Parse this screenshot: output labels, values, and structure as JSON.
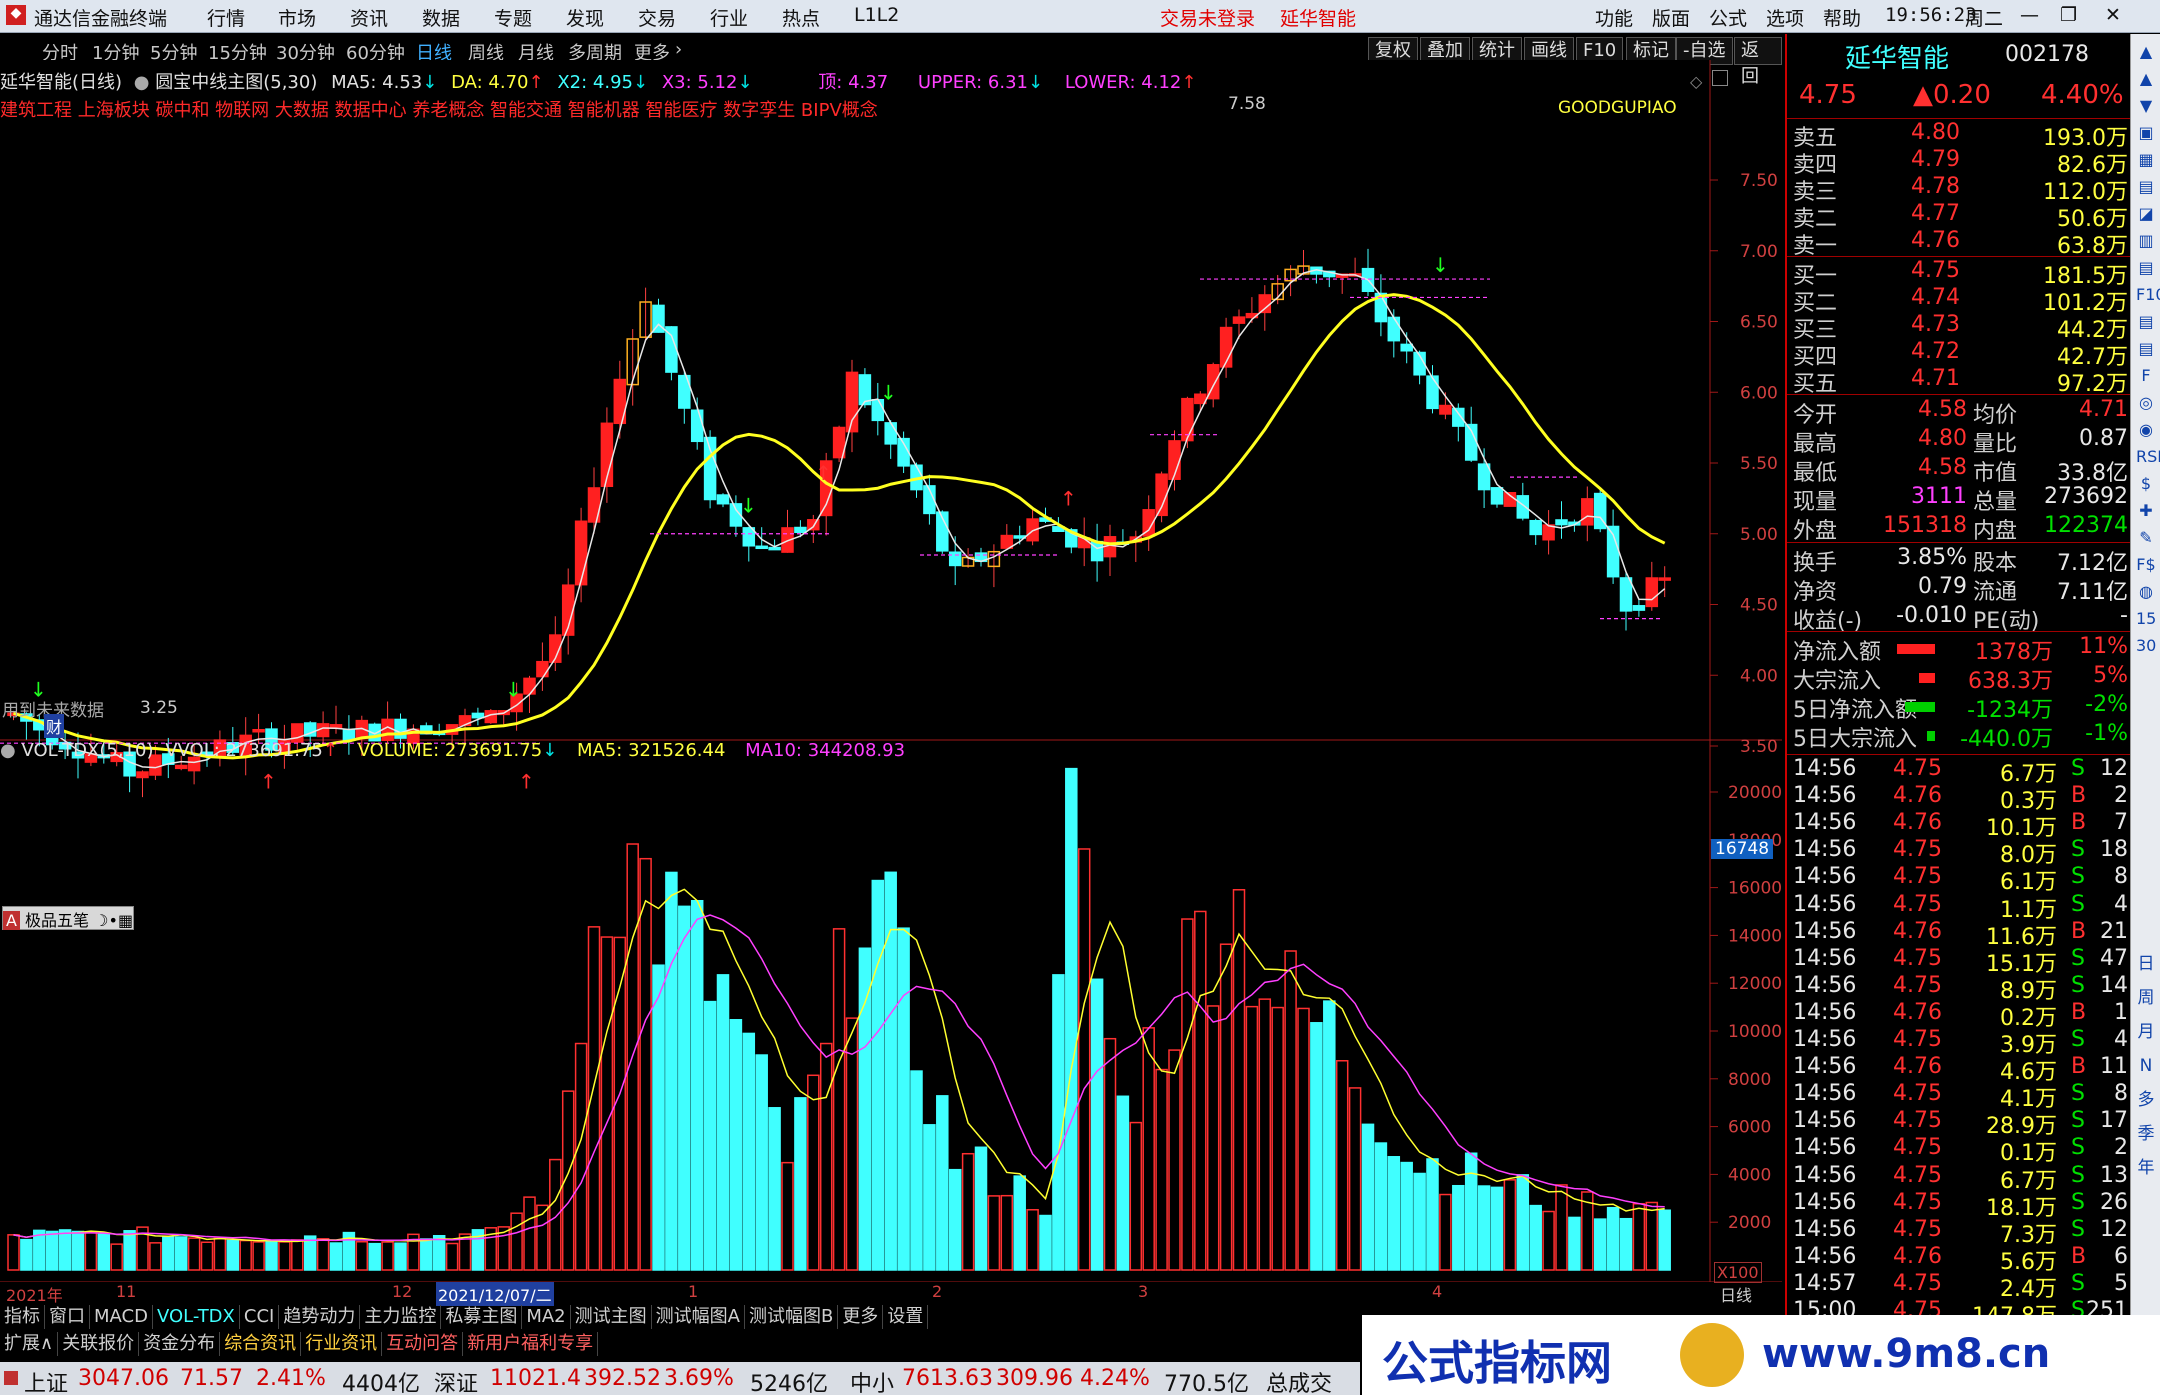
{
  "app": {
    "title": "通达信金融终端",
    "menus": [
      "行情",
      "市场",
      "资讯",
      "数据",
      "专题",
      "发现",
      "交易",
      "行业",
      "热点",
      "L1L2"
    ],
    "login": "交易未登录",
    "stock_title": "延华智能",
    "right_menus": [
      "功能",
      "版面",
      "公式",
      "选项",
      "帮助"
    ],
    "time": "19:56:23",
    "weekday": "周二"
  },
  "toolbar": {
    "periods": [
      "分时",
      "1分钟",
      "5分钟",
      "15分钟",
      "30分钟",
      "60分钟",
      "日线",
      "周线",
      "月线",
      "多周期",
      "更多"
    ],
    "active": "日线",
    "buttons": [
      "复权",
      "叠加",
      "统计",
      "画线",
      "F10",
      "标记",
      "-自选",
      "返回"
    ]
  },
  "main_info": {
    "name": "延华智能(日线)",
    "formula": "圆宝中线主图(5,30)",
    "ma5": "MA5: 4.53",
    "da": "DA: 4.70",
    "x2": "X2: 4.95",
    "x3": "X3: 5.12",
    "top": "顶: 4.37",
    "upper": "UPPER: 6.31",
    "lower": "LOWER: 4.12",
    "concepts": "建筑工程 上海板块 碳中和 物联网 大数据 数据中心 养老概念 智能交通 智能机器 智能医疗 数字孪生 BIPV概念",
    "watermark": "GOODGUPIAO",
    "future": "用到未来数据",
    "finance": "财",
    "high_label": "7.58",
    "low_label": "3.25"
  },
  "y_axis": [
    "7.50",
    "7.00",
    "6.50",
    "6.00",
    "5.50",
    "5.00",
    "4.50",
    "4.00",
    "3.50"
  ],
  "vol_info": {
    "name": "VOL-TDX(5,10)",
    "vvol": "VVOL: 273691.75",
    "volume": "VOLUME: 273691.75",
    "ma5": "MA5: 321526.44",
    "ma10": "MA10: 344208.93",
    "cursor": "16748",
    "unit": "X100"
  },
  "vol_axis": [
    "20000",
    "18000",
    "16000",
    "14000",
    "12000",
    "10000",
    "8000",
    "6000",
    "4000",
    "2000"
  ],
  "x_axis": {
    "year": "2021年",
    "m11": "11",
    "m12": "12",
    "cursor_date": "2021/12/07/二",
    "m1": "1",
    "m2": "2",
    "m3": "3",
    "m4": "4",
    "period": "日线"
  },
  "tabs_row1": [
    "指标",
    "窗口",
    "MACD",
    "VOL-TDX",
    "CCI",
    "趋势动力",
    "主力监控",
    "私募主图",
    "MA2",
    "测试主图",
    "测试幅图A",
    "测试幅图B",
    "更多",
    "设置"
  ],
  "tabs_row2": [
    "扩展∧",
    "关联报价",
    "资金分布",
    "综合资讯",
    "行业资讯",
    "互动问答",
    "新用户福利专享"
  ],
  "ime": "极品五笔",
  "status": [
    {
      "name": "上证",
      "val": "3047.06",
      "chg": "71.57",
      "pct": "2.41%",
      "amt": "4404亿"
    },
    {
      "name": "深证",
      "val": "11021.4",
      "chg": "392.52",
      "pct": "3.69%",
      "amt": "5246亿"
    },
    {
      "name": "中小",
      "val": "7613.63",
      "chg": "309.96",
      "pct": "4.24%",
      "amt": "770.5亿"
    }
  ],
  "status_tail": "总成交",
  "quote": {
    "name": "延华智能",
    "code": "002178",
    "price": "4.75",
    "change": "▲0.20",
    "pct": "4.40%",
    "asks": [
      [
        "卖五",
        "4.80",
        "193.0万"
      ],
      [
        "卖四",
        "4.79",
        "82.6万"
      ],
      [
        "卖三",
        "4.78",
        "112.0万"
      ],
      [
        "卖二",
        "4.77",
        "50.6万"
      ],
      [
        "卖一",
        "4.76",
        "63.8万"
      ]
    ],
    "bids": [
      [
        "买一",
        "4.75",
        "181.5万"
      ],
      [
        "买二",
        "4.74",
        "101.2万"
      ],
      [
        "买三",
        "4.73",
        "44.2万"
      ],
      [
        "买四",
        "4.72",
        "42.7万"
      ],
      [
        "买五",
        "4.71",
        "97.2万"
      ]
    ],
    "stats": [
      [
        "今开",
        "4.58",
        "均价",
        "4.71"
      ],
      [
        "最高",
        "4.80",
        "量比",
        "0.87"
      ],
      [
        "最低",
        "4.58",
        "市值",
        "33.8亿"
      ],
      [
        "现量",
        "3111",
        "总量",
        "273692"
      ],
      [
        "外盘",
        "151318",
        "内盘",
        "122374"
      ]
    ],
    "stats2": [
      [
        "换手",
        "3.85%",
        "股本",
        "7.12亿"
      ],
      [
        "净资",
        "0.79",
        "流通",
        "7.11亿"
      ],
      [
        "收益(-)",
        "-0.010",
        "PE(动)",
        "-"
      ]
    ],
    "flows": [
      [
        "净流入额",
        "1378万",
        "11%"
      ],
      [
        "大宗流入",
        "638.3万",
        "5%"
      ],
      [
        "5日净流入额",
        "-1234万",
        "-2%"
      ],
      [
        "5日大宗流入",
        "-440.0万",
        "-1%"
      ]
    ],
    "ticks": [
      [
        "14:56",
        "4.75",
        "6.7万",
        "S",
        "12"
      ],
      [
        "14:56",
        "4.76",
        "0.3万",
        "B",
        "2"
      ],
      [
        "14:56",
        "4.76",
        "10.1万",
        "B",
        "7"
      ],
      [
        "14:56",
        "4.75",
        "8.0万",
        "S",
        "18"
      ],
      [
        "14:56",
        "4.75",
        "6.1万",
        "S",
        "8"
      ],
      [
        "14:56",
        "4.75",
        "1.1万",
        "S",
        "4"
      ],
      [
        "14:56",
        "4.76",
        "11.6万",
        "B",
        "21"
      ],
      [
        "14:56",
        "4.75",
        "15.1万",
        "S",
        "47"
      ],
      [
        "14:56",
        "4.75",
        "8.9万",
        "S",
        "14"
      ],
      [
        "14:56",
        "4.76",
        "0.2万",
        "B",
        "1"
      ],
      [
        "14:56",
        "4.75",
        "3.9万",
        "S",
        "4"
      ],
      [
        "14:56",
        "4.76",
        "4.6万",
        "B",
        "11"
      ],
      [
        "14:56",
        "4.75",
        "4.1万",
        "S",
        "8"
      ],
      [
        "14:56",
        "4.75",
        "28.9万",
        "S",
        "17"
      ],
      [
        "14:56",
        "4.75",
        "0.1万",
        "S",
        "2"
      ],
      [
        "14:56",
        "4.75",
        "6.7万",
        "S",
        "13"
      ],
      [
        "14:56",
        "4.75",
        "18.1万",
        "S",
        "26"
      ],
      [
        "14:56",
        "4.75",
        "7.3万",
        "S",
        "12"
      ],
      [
        "14:56",
        "4.76",
        "5.6万",
        "B",
        "6"
      ],
      [
        "14:57",
        "4.75",
        "2.4万",
        "S",
        "5"
      ],
      [
        "15:00",
        "4.75",
        "147.8万",
        "S",
        "251"
      ]
    ]
  },
  "sidebar": [
    "日",
    "周",
    "月",
    "N",
    "多",
    "季",
    "年"
  ],
  "banner": {
    "text": "公式指标网",
    "url": "www.9m8.cn"
  }
}
